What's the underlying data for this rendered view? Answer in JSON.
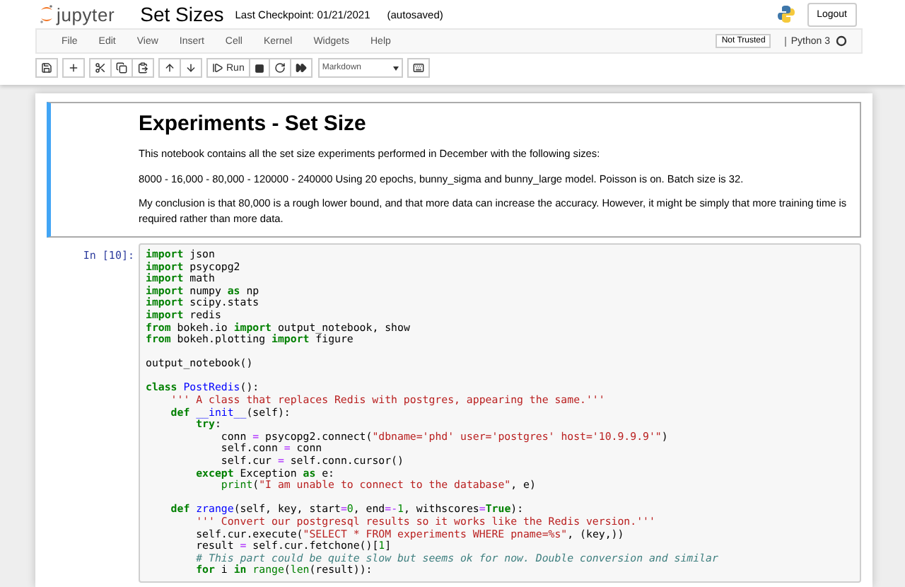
{
  "header": {
    "logo_text": "jupyter",
    "title": "Set Sizes",
    "checkpoint": "Last Checkpoint: 01/21/2021",
    "autosave": "(autosaved)",
    "logout": "Logout"
  },
  "menu": [
    "File",
    "Edit",
    "View",
    "Insert",
    "Cell",
    "Kernel",
    "Widgets",
    "Help"
  ],
  "trust": "Not Trusted",
  "kernel": {
    "name": "Python 3",
    "busy": false
  },
  "toolbar": {
    "run": "Run",
    "cell_type": "Markdown"
  },
  "markdown_cell": {
    "selected": true,
    "heading": "Experiments - Set Size",
    "paragraphs": [
      "This notebook contains all the set size experiments performed in December with the following sizes:",
      "8000 - 16,000 - 80,000 - 120000 - 240000 Using 20 epochs, bunny_sigma and bunny_large model. Poisson is on. Batch size is 32.",
      "My conclusion is that 80,000 is a rough lower bound, and that more data can increase the accuracy. However, it might be simply that more training time is required rather than more data."
    ]
  },
  "code_cell": {
    "prompt": "In [10]:",
    "lines": [
      {
        "kind": "code",
        "tokens": [
          {
            "kind": "kw",
            "t": "import"
          },
          {
            "kind": "plain",
            "t": " json"
          }
        ]
      },
      {
        "kind": "code",
        "tokens": [
          {
            "kind": "kw",
            "t": "import"
          },
          {
            "kind": "plain",
            "t": " psycopg2"
          }
        ]
      },
      {
        "kind": "code",
        "tokens": [
          {
            "kind": "kw",
            "t": "import"
          },
          {
            "kind": "plain",
            "t": " math"
          }
        ]
      },
      {
        "kind": "code",
        "tokens": [
          {
            "kind": "kw",
            "t": "import"
          },
          {
            "kind": "plain",
            "t": " numpy "
          },
          {
            "kind": "kw",
            "t": "as"
          },
          {
            "kind": "plain",
            "t": " np"
          }
        ]
      },
      {
        "kind": "code",
        "tokens": [
          {
            "kind": "kw",
            "t": "import"
          },
          {
            "kind": "plain",
            "t": " scipy.stats"
          }
        ]
      },
      {
        "kind": "code",
        "tokens": [
          {
            "kind": "kw",
            "t": "import"
          },
          {
            "kind": "plain",
            "t": " redis"
          }
        ]
      },
      {
        "kind": "code",
        "tokens": [
          {
            "kind": "kw",
            "t": "from"
          },
          {
            "kind": "plain",
            "t": " bokeh.io "
          },
          {
            "kind": "kw",
            "t": "import"
          },
          {
            "kind": "plain",
            "t": " output_notebook, show"
          }
        ]
      },
      {
        "kind": "code",
        "tokens": [
          {
            "kind": "kw",
            "t": "from"
          },
          {
            "kind": "plain",
            "t": " bokeh.plotting "
          },
          {
            "kind": "kw",
            "t": "import"
          },
          {
            "kind": "plain",
            "t": " figure"
          }
        ]
      },
      {
        "kind": "blank"
      },
      {
        "kind": "code",
        "tokens": [
          {
            "kind": "plain",
            "t": "output_notebook()"
          }
        ]
      },
      {
        "kind": "blank"
      },
      {
        "kind": "code",
        "tokens": [
          {
            "kind": "kw",
            "t": "class "
          },
          {
            "kind": "fn",
            "t": "PostRedis"
          },
          {
            "kind": "plain",
            "t": "():"
          }
        ]
      },
      {
        "kind": "code",
        "tokens": [
          {
            "kind": "str",
            "t": "    ''' A class that replaces Redis with postgres, appearing the same.'''"
          }
        ]
      },
      {
        "kind": "code",
        "tokens": [
          {
            "kind": "kw",
            "t": "    def "
          },
          {
            "kind": "fn",
            "t": "__init__"
          },
          {
            "kind": "plain",
            "t": "(self):"
          }
        ]
      },
      {
        "kind": "code",
        "tokens": [
          {
            "kind": "kw",
            "t": "        try"
          },
          {
            "kind": "plain",
            "t": ":"
          }
        ]
      },
      {
        "kind": "code",
        "tokens": [
          {
            "kind": "plain",
            "t": "            conn "
          },
          {
            "kind": "op",
            "t": "="
          },
          {
            "kind": "plain",
            "t": " psycopg2.connect("
          },
          {
            "kind": "str",
            "t": "\"dbname='phd' user='postgres' host='10.9.9.9'\""
          },
          {
            "kind": "plain",
            "t": ")"
          }
        ]
      },
      {
        "kind": "code",
        "tokens": [
          {
            "kind": "plain",
            "t": "            self.conn "
          },
          {
            "kind": "op",
            "t": "="
          },
          {
            "kind": "plain",
            "t": " conn"
          }
        ]
      },
      {
        "kind": "code",
        "tokens": [
          {
            "kind": "plain",
            "t": "            self.cur "
          },
          {
            "kind": "op",
            "t": "="
          },
          {
            "kind": "plain",
            "t": " self.conn.cursor()"
          }
        ]
      },
      {
        "kind": "code",
        "tokens": [
          {
            "kind": "kw",
            "t": "        except"
          },
          {
            "kind": "plain",
            "t": " Exception "
          },
          {
            "kind": "kw",
            "t": "as"
          },
          {
            "kind": "plain",
            "t": " e:"
          }
        ]
      },
      {
        "kind": "code",
        "tokens": [
          {
            "kind": "bi",
            "t": "            print"
          },
          {
            "kind": "plain",
            "t": "("
          },
          {
            "kind": "str",
            "t": "\"I am unable to connect to the database\""
          },
          {
            "kind": "plain",
            "t": ", e)"
          }
        ]
      },
      {
        "kind": "blank"
      },
      {
        "kind": "code",
        "tokens": [
          {
            "kind": "kw",
            "t": "    def "
          },
          {
            "kind": "fn",
            "t": "zrange"
          },
          {
            "kind": "plain",
            "t": "(self, key, start"
          },
          {
            "kind": "op",
            "t": "="
          },
          {
            "kind": "num",
            "t": "0"
          },
          {
            "kind": "plain",
            "t": ", end"
          },
          {
            "kind": "op",
            "t": "=-"
          },
          {
            "kind": "num",
            "t": "1"
          },
          {
            "kind": "plain",
            "t": ", withscores"
          },
          {
            "kind": "op",
            "t": "="
          },
          {
            "kind": "kw",
            "t": "True"
          },
          {
            "kind": "plain",
            "t": "):"
          }
        ]
      },
      {
        "kind": "code",
        "tokens": [
          {
            "kind": "str",
            "t": "        ''' Convert our postgresql results so it works like the Redis version.'''"
          }
        ]
      },
      {
        "kind": "code",
        "tokens": [
          {
            "kind": "plain",
            "t": "        self.cur.execute("
          },
          {
            "kind": "str",
            "t": "\"SELECT * FROM experiments WHERE pname=%s\""
          },
          {
            "kind": "plain",
            "t": ", (key,))"
          }
        ]
      },
      {
        "kind": "code",
        "tokens": [
          {
            "kind": "plain",
            "t": "        result "
          },
          {
            "kind": "op",
            "t": "="
          },
          {
            "kind": "plain",
            "t": " self.cur.fetchone()["
          },
          {
            "kind": "num",
            "t": "1"
          },
          {
            "kind": "plain",
            "t": "]"
          }
        ]
      },
      {
        "kind": "code",
        "tokens": [
          {
            "kind": "cm",
            "t": "        # This part could be quite slow but seems ok for now. Double conversion and similar"
          }
        ]
      },
      {
        "kind": "code",
        "tokens": [
          {
            "kind": "kw",
            "t": "        for"
          },
          {
            "kind": "plain",
            "t": " i "
          },
          {
            "kind": "kw",
            "t": "in "
          },
          {
            "kind": "bi",
            "t": "range"
          },
          {
            "kind": "plain",
            "t": "("
          },
          {
            "kind": "bi",
            "t": "len"
          },
          {
            "kind": "plain",
            "t": "(result)):"
          }
        ]
      }
    ]
  }
}
